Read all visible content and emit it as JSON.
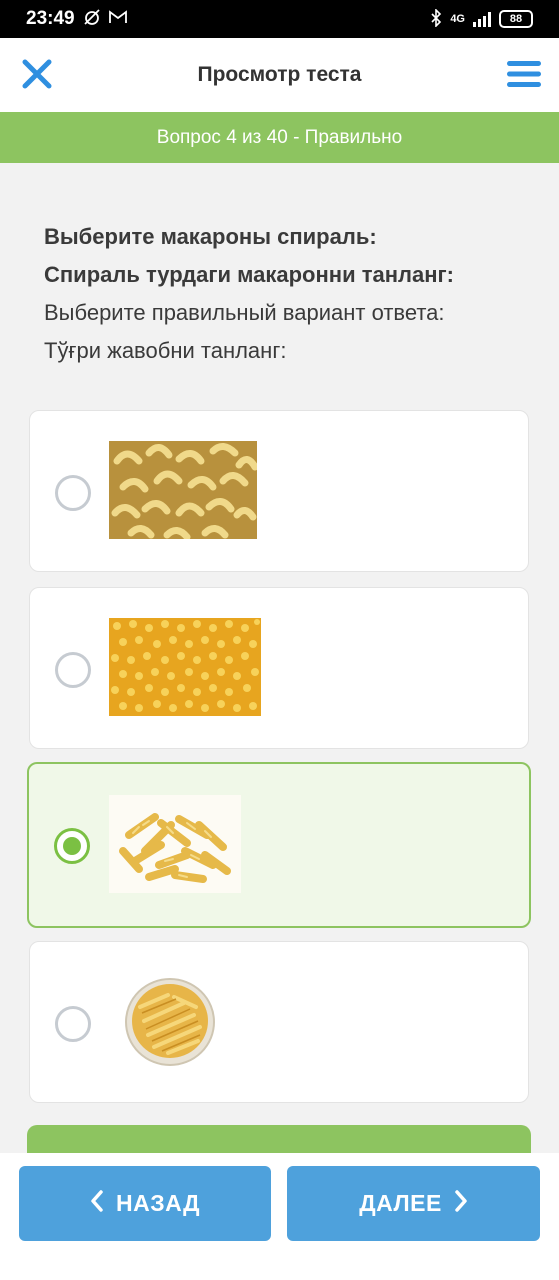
{
  "status": {
    "time": "23:49",
    "network": "4G",
    "battery": "88"
  },
  "header": {
    "title": "Просмотр теста"
  },
  "progress": {
    "text": "Вопрос 4 из 40 - Правильно"
  },
  "question": {
    "line1": "Выберите макароны спираль:",
    "line2": "Спираль турдаги макаронни танланг:",
    "line3": "Выберите правильный вариант ответа:",
    "line4": "Тўғри жавобни танланг:"
  },
  "options": [
    {
      "image": "elbow-macaroni-photo",
      "selected": false
    },
    {
      "image": "star-pasta-photo",
      "selected": false
    },
    {
      "image": "spiral-fusilli-photo",
      "selected": true
    },
    {
      "image": "penne-in-bowl-photo",
      "selected": false
    }
  ],
  "nav": {
    "back_label": "НАЗАД",
    "next_label": "ДАЛЕЕ"
  },
  "colors": {
    "accent_green": "#8dc460",
    "button_blue": "#4ea1dc",
    "close_blue": "#2f8fe0"
  }
}
